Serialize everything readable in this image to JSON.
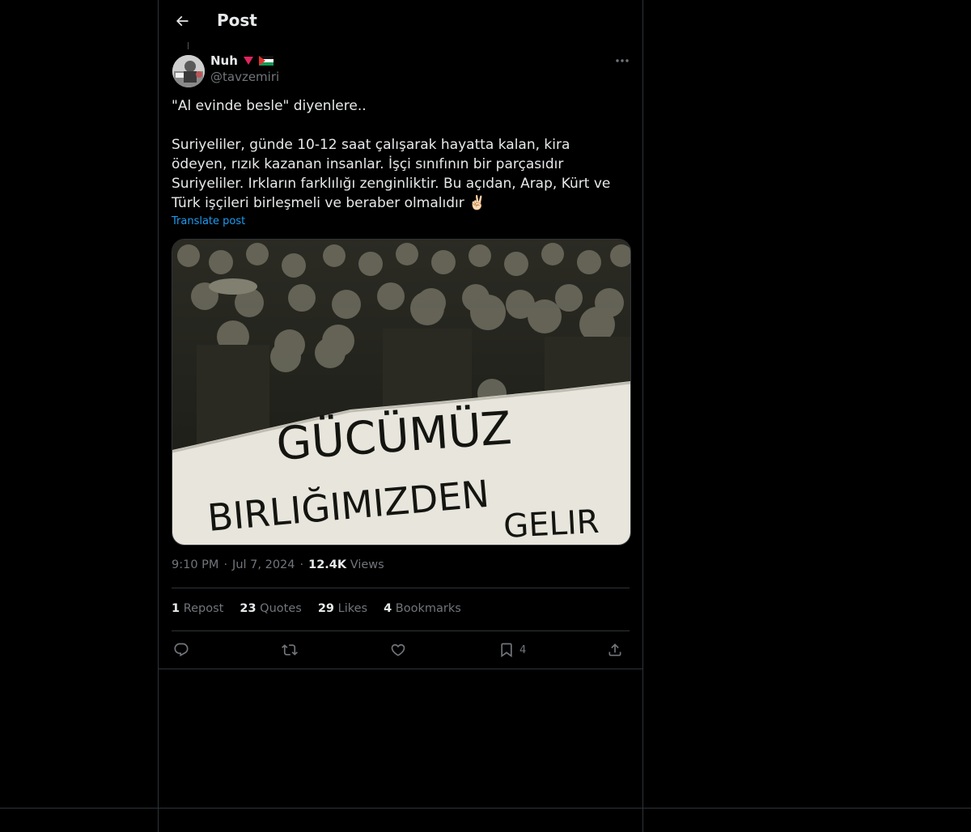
{
  "header": {
    "title": "Post"
  },
  "author": {
    "display_name": "Nuh",
    "handle": "@tavzemiri",
    "badges": [
      "red-heart-down-icon",
      "palestine-flag-icon"
    ]
  },
  "post": {
    "line1": "\"Al evinde besle\" diyenlere..",
    "body": "Suriyeliler, günde 10-12 saat çalışarak hayatta kalan, kira ödeyen, rızık kazanan insanlar. İşçi sınıfının bir parçasıdır Suriyeliler. Irkların farklılığı zenginliktir. Bu açıdan, Arap, Kürt ve Türk işçileri birleşmeli ve beraber olmalıdır ✌🏻",
    "translate_label": "Translate post"
  },
  "media": {
    "banner_line1": "GÜCÜMÜZ",
    "banner_line2": "BIRLIĞIMIZDEN",
    "banner_line3": "GELIR"
  },
  "meta": {
    "time": "9:10 PM",
    "date": "Jul 7, 2024",
    "views_count": "12.4K",
    "views_label": "Views",
    "separator": "·"
  },
  "stats": {
    "reposts_count": "1",
    "reposts_label": "Repost",
    "quotes_count": "23",
    "quotes_label": "Quotes",
    "likes_count": "29",
    "likes_label": "Likes",
    "bookmarks_count": "4",
    "bookmarks_label": "Bookmarks"
  },
  "actions": {
    "bookmark_count": "4"
  },
  "colors": {
    "background": "#000000",
    "text": "#e7e9ea",
    "muted": "#71767b",
    "link": "#1d9bf0",
    "border": "#2f3336"
  }
}
